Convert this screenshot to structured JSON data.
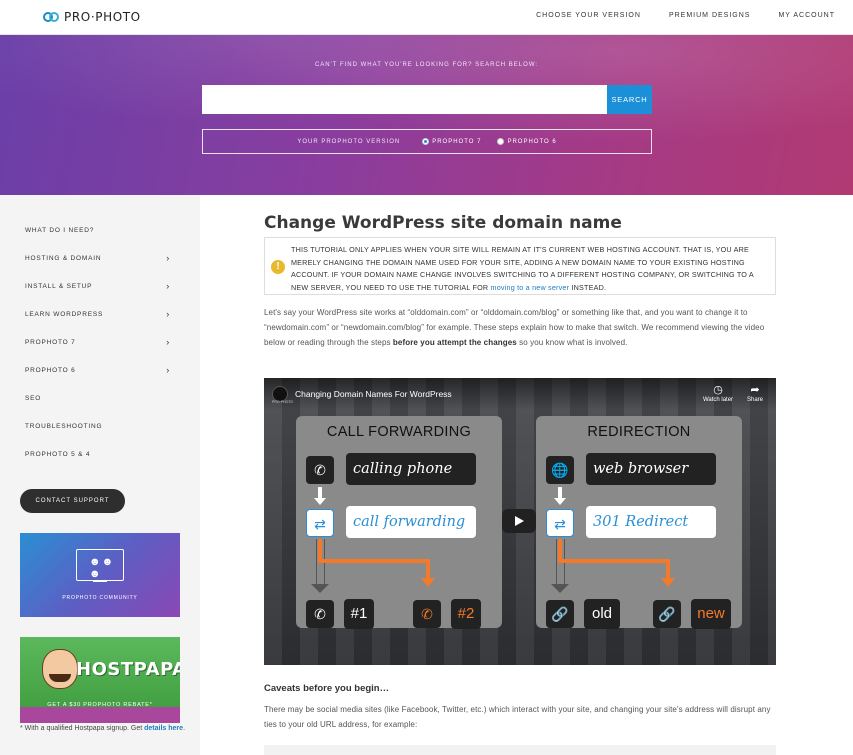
{
  "header": {
    "logo_text": "PRO·PHOTO",
    "nav": [
      "CHOOSE YOUR VERSION",
      "PREMIUM DESIGNS",
      "MY ACCOUNT"
    ]
  },
  "hero": {
    "search_label": "CAN'T FIND WHAT YOU'RE LOOKING FOR? SEARCH BELOW:",
    "search_value": "",
    "search_button": "SEARCH",
    "version_label": "YOUR PROPHOTO VERSION",
    "versions": [
      {
        "label": "PROPHOTO 7",
        "selected": true
      },
      {
        "label": "PROPHOTO 6",
        "selected": false
      }
    ]
  },
  "sidebar": {
    "items": [
      {
        "label": "WHAT DO I NEED?",
        "chevron": ""
      },
      {
        "label": "HOSTING & DOMAIN",
        "chevron": "›"
      },
      {
        "label": "INSTALL & SETUP",
        "chevron": "›"
      },
      {
        "label": "LEARN WORDPRESS",
        "chevron": "›"
      },
      {
        "label": "PROPHOTO 7",
        "chevron": "›"
      },
      {
        "label": "PROPHOTO 6",
        "chevron": "›"
      },
      {
        "label": "SEO",
        "chevron": ""
      },
      {
        "label": "TROUBLESHOOTING",
        "chevron": ""
      },
      {
        "label": "PROPHOTO 5 & 4",
        "chevron": ""
      }
    ],
    "contact_button": "CONTACT SUPPORT",
    "community_caption": "PROPHOTO COMMUNITY",
    "hostpapa_brand": "HOSTPAPA",
    "hostpapa_caption": "GET A $30 PROPHOTO REBATE*",
    "note_prefix": "* With a qualified Hostpapa signup. Get ",
    "note_link": "details here",
    "note_suffix": "."
  },
  "article": {
    "title": "Change WordPress site domain name",
    "notice_text": "THIS TUTORIAL ONLY APPLIES WHEN YOUR SITE WILL REMAIN AT IT'S CURRENT WEB HOSTING ACCOUNT. THAT IS, YOU ARE MERELY CHANGING THE DOMAIN NAME USED FOR YOUR SITE, ADDING A NEW DOMAIN NAME TO YOUR EXISTING HOSTING ACCOUNT. IF YOUR DOMAIN NAME CHANGE INVOLVES SWITCHING TO A DIFFERENT HOSTING COMPANY, OR SWITCHING TO A NEW SERVER, YOU NEED TO USE THE TUTORIAL FOR ",
    "notice_link": "moving to a new server",
    "notice_suffix": " INSTEAD.",
    "intro_1": "Let's say your WordPress site works at “olddomain.com” or “olddomain.com/blog” or something like that, and you want to change it to “newdomain.com” or “newdomain.com/blog” for example. These steps explain how to make that switch. We recommend viewing the video below or reading through the steps ",
    "intro_bold": "before you attempt the changes",
    "intro_2": " so you know what is involved.",
    "caveats_heading": "Caveats before you begin…",
    "caveats_text": "There may be social media sites (like Facebook, Twitter, etc.) which interact with your site, and changing your site's address will disrupt any ties to your old URL address, for example:"
  },
  "video": {
    "channel": "PRO·PHOTO",
    "title": "Changing Domain Names For WordPress",
    "watch_later": "Watch later",
    "share": "Share",
    "left_panel": {
      "title": "CALL FORWARDING",
      "top_text": "calling phone",
      "mid_text": "call forwarding",
      "out_1": "#1",
      "out_2": "#2"
    },
    "right_panel": {
      "title": "REDIRECTION",
      "top_text": "web browser",
      "mid_text": "301 Redirect",
      "out_1": "old",
      "out_2": "new"
    }
  },
  "colors": {
    "accent": "#1b8fd8",
    "orange": "#f37a2a",
    "warning": "#e8b92c"
  }
}
